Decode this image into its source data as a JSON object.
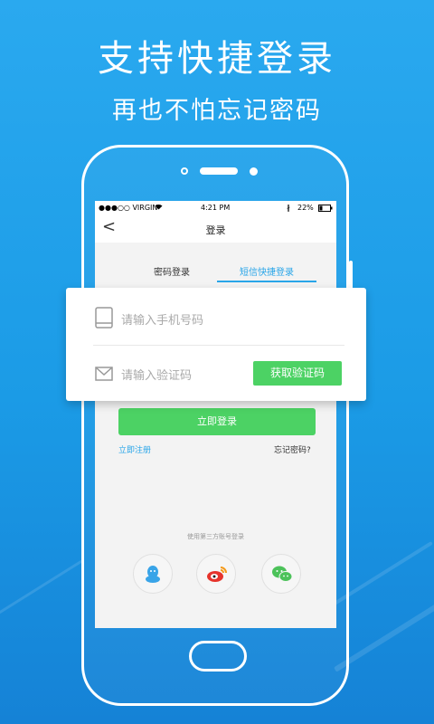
{
  "headline": {
    "title": "支持快捷登录",
    "subtitle": "再也不怕忘记密码"
  },
  "status_bar": {
    "carrier": "●●●○○ VIRGIN",
    "time": "4:21 PM",
    "battery": "22%"
  },
  "nav": {
    "back": "<",
    "title": "登录"
  },
  "tabs": [
    {
      "label": "密码登录"
    },
    {
      "label": "短信快捷登录"
    }
  ],
  "form": {
    "phone_placeholder": "请输入手机号码",
    "code_placeholder": "请输入验证码",
    "get_code_label": "获取验证码"
  },
  "login_button": "立即登录",
  "register_link": "立即注册",
  "forgot_link": "忘记密码?",
  "third_party_label": "使用第三方账号登录",
  "social": [
    {
      "icon": "qq-icon"
    },
    {
      "icon": "weibo-icon"
    },
    {
      "icon": "wechat-icon"
    }
  ],
  "colors": {
    "background": "#1e9fe8",
    "accent_blue": "#29a5e8",
    "accent_green": "#4cd264"
  }
}
